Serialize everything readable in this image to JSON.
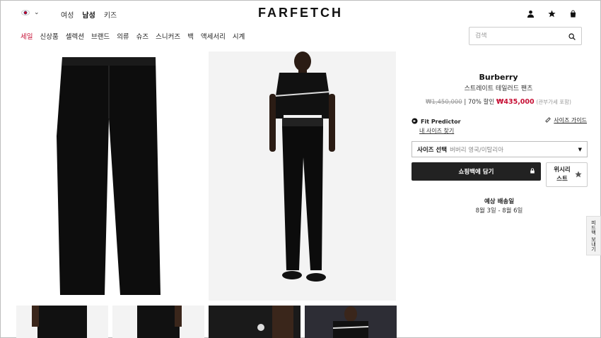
{
  "header": {
    "logo": "FARFETCH",
    "gender_tabs": [
      {
        "label": "여성",
        "active": false
      },
      {
        "label": "남성",
        "active": true
      },
      {
        "label": "키즈",
        "active": false
      }
    ],
    "icons": [
      "user-icon",
      "star-icon",
      "bag-icon"
    ]
  },
  "nav": {
    "items": [
      "세일",
      "신상품",
      "셀렉션",
      "브랜드",
      "의류",
      "슈즈",
      "스니커즈",
      "백",
      "액세서리",
      "시계"
    ],
    "sale_color": "#c60f34"
  },
  "search": {
    "placeholder": "검색"
  },
  "product": {
    "brand": "Burberry",
    "name": "스트레이트 테일러드 팬츠",
    "old_price": "₩1,450,000",
    "discount": "| 70% 할인",
    "new_price": "₩435,000",
    "tax_note": "(관부가세 포함)"
  },
  "fit": {
    "title": "Fit Predictor",
    "link": "내 사이즈 찾기",
    "size_guide": "사이즈 가이드"
  },
  "size_select": {
    "label": "사이즈 선택",
    "value": "버버리 영국/이탈리아"
  },
  "actions": {
    "bag": "쇼핑백에 담기",
    "wishlist": "위시리스트"
  },
  "shipping": {
    "title": "예상 배송일",
    "date": "8월 3일 - 8월 6일"
  },
  "feedback": "피드백 보내기"
}
